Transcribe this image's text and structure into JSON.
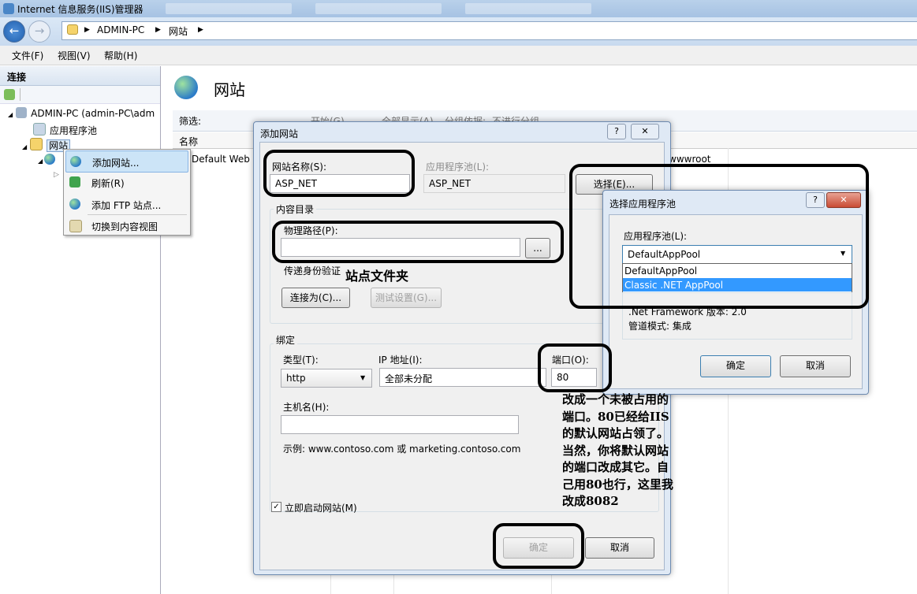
{
  "window": {
    "title": "Internet 信息服务(IIS)管理器",
    "breadcrumb": [
      "ADMIN-PC",
      "网站"
    ]
  },
  "menu": [
    "文件(F)",
    "视图(V)",
    "帮助(H)"
  ],
  "left_pane": {
    "header": "连接",
    "tree": {
      "server": "ADMIN-PC (admin-PC\\adm",
      "app_pools": "应用程序池",
      "sites": "网站"
    }
  },
  "main": {
    "title": "网站",
    "filter_label": "筛选:",
    "start_label": "开始(G)",
    "show_all_label": "全部显示(A)",
    "group_by_label": "分组依据:",
    "group_by_value": "不进行分组",
    "col_name": "名称",
    "row_site": "Default Web",
    "row_path": "wwwroot"
  },
  "context_menu": {
    "items": [
      "添加网站...",
      "刷新(R)",
      "添加 FTP 站点...",
      "切换到内容视图"
    ]
  },
  "add_site_dialog": {
    "title": "添加网站",
    "help": "?",
    "site_name_label": "网站名称(S):",
    "site_name_value": "ASP_NET",
    "app_pool_label": "应用程序池(L):",
    "app_pool_value": "ASP_NET",
    "select_button": "选择(E)...",
    "content_dir_label": "内容目录",
    "physical_path_label": "物理路径(P):",
    "browse_button": "...",
    "pass_through_label": "传递身份验证",
    "connect_as_button": "连接为(C)...",
    "test_settings_button": "测试设置(G)...",
    "binding_label": "绑定",
    "type_label": "类型(T):",
    "type_value": "http",
    "ip_label": "IP 地址(I):",
    "ip_value": "全部未分配",
    "port_label": "端口(O):",
    "port_value": "80",
    "host_label": "主机名(H):",
    "host_value": "",
    "example_text": "示例: www.contoso.com 或 marketing.contoso.com",
    "start_now_label": "立即启动网站(M)",
    "start_now_checked": true,
    "ok_button": "确定",
    "cancel_button": "取消"
  },
  "app_pool_dialog": {
    "title": "选择应用程序池",
    "help": "?",
    "pool_label": "应用程序池(L):",
    "selected": "DefaultAppPool",
    "options": [
      "DefaultAppPool",
      "Classic .NET AppPool"
    ],
    "framework_text": ".Net Framework 版本: 2.0",
    "pipeline_text": "管道模式: 集成",
    "ok_button": "确定",
    "cancel_button": "取消"
  },
  "annotations": {
    "site_folder": "站点文件夹",
    "port_note": "改成一个未被占用的\n端口。80已经给IIS\n的默认网站占领了。\n当然，你将默认网站\n的端口改成其它。自\n己用80也行，这里我\n改成8082"
  },
  "colors": {
    "title_bar": "#b9d1ea",
    "selection": "#3399ff",
    "highlight": "#cce4f7",
    "annotation": "#000000"
  }
}
